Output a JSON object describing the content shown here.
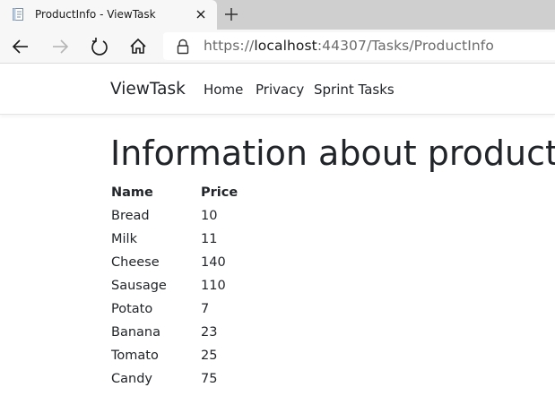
{
  "browser": {
    "tab_title": "ProductInfo - ViewTask",
    "url_scheme": "https://",
    "url_host": "localhost",
    "url_rest": ":44307/Tasks/ProductInfo",
    "icons": {
      "favicon": "page-icon",
      "close": "close-icon",
      "new_tab": "plus-icon",
      "back": "arrow-left-icon",
      "forward": "arrow-right-icon",
      "refresh": "refresh-icon",
      "home": "home-icon",
      "lock": "lock-icon"
    }
  },
  "navbar": {
    "brand": "ViewTask",
    "links": [
      "Home",
      "Privacy",
      "Sprint Tasks"
    ]
  },
  "main": {
    "title": "Information about product",
    "table": {
      "headers": [
        "Name",
        "Price"
      ],
      "rows": [
        [
          "Bread",
          "10"
        ],
        [
          "Milk",
          "11"
        ],
        [
          "Cheese",
          "140"
        ],
        [
          "Sausage",
          "110"
        ],
        [
          "Potato",
          "7"
        ],
        [
          "Banana",
          "23"
        ],
        [
          "Tomato",
          "25"
        ],
        [
          "Candy",
          "75"
        ]
      ]
    }
  },
  "colors": {
    "tabstrip": "#cfcfcf",
    "toolbar": "#f7f7f7",
    "text": "#212529"
  }
}
